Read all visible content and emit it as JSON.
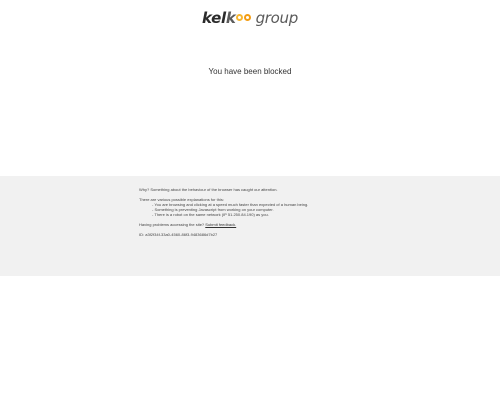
{
  "brand": {
    "kel": "kel",
    "ko": "k",
    "group": "group",
    "accent_color_1": "#f7b731",
    "accent_color_2": "#f39c12"
  },
  "headline": "You have been blocked",
  "details": {
    "why": "Why? Something about the behaviour of the browser has caught our attention.",
    "explanations_intro": "There are various possible explanations for this:",
    "reasons": [
      "- You are browsing and clicking at a speed much faster than expected of a human being.",
      "- Something is preventing Javascript from working on your computer.",
      "- There is a robot on the same network (IP 51.250.84.190) as you."
    ],
    "problems_text": "Having problems accessing the site?",
    "feedback_link": "Submit feedback.",
    "id_line": "ID: a3f2f34f-33a0-4560-86f3-9483686d7b27"
  }
}
